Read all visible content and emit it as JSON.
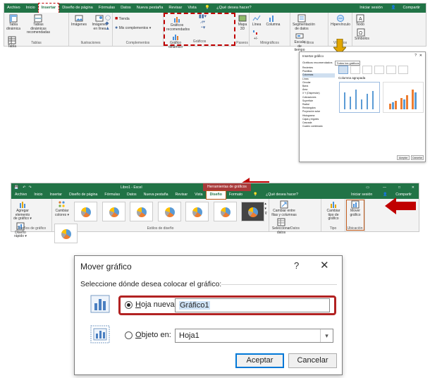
{
  "ribbon1": {
    "tabs": [
      "Archivo",
      "Inicio",
      "Insertar",
      "Diseño de página",
      "Fórmulas",
      "Datos",
      "Nueva pestaña",
      "Revisar",
      "Vista"
    ],
    "tell_me": "¿Qué desea hacer?",
    "signin": "Iniciar sesión",
    "share": "Compartir",
    "groups": {
      "tablas": {
        "label": "Tablas",
        "buttons": [
          "Tabla dinámica",
          "Tablas dinámicas recomendadas",
          "Tabla"
        ]
      },
      "ilustraciones": {
        "label": "Ilustraciones",
        "buttons": [
          "Imágenes",
          "Imágenes en línea"
        ]
      },
      "complementos": {
        "label": "Complementos",
        "buttons": [
          "Tienda",
          "Mis complementos"
        ]
      },
      "graficos": {
        "label": "Gráficos",
        "buttons": [
          "Gráficos recomendados",
          "Gráfico dinámico"
        ]
      },
      "paseos": {
        "label": "Paseos",
        "buttons": [
          "Mapa 3D"
        ]
      },
      "minigraficos": {
        "label": "Minigráficos",
        "buttons": [
          "Línea",
          "Columna",
          "+/-"
        ]
      },
      "filtros": {
        "label": "Filtros",
        "buttons": [
          "Segmentación de datos",
          "Escala de tiempo"
        ]
      },
      "vinculos": {
        "label": "Vínculos",
        "buttons": [
          "Hipervínculo"
        ]
      },
      "texto": {
        "buttons": [
          "Texto",
          "Símbolos"
        ]
      }
    }
  },
  "dialog_small": {
    "title": "Insertar gráfico",
    "tabs": [
      "Gráficos recomendados",
      "Todos los gráficos"
    ],
    "categories": [
      "Recientes",
      "Plantillas",
      "Columnas",
      "Línea",
      "Circular",
      "Barra",
      "Área",
      "X Y (Dispersión)",
      "Cotizaciones",
      "Superficie",
      "Radial",
      "Rectángulos",
      "Proyección solar",
      "Histograma",
      "Cajas y bigotes",
      "Cascada",
      "Cuadro combinado"
    ],
    "heading": "Columna agrupada",
    "ok": "Aceptar",
    "cancel": "Cancelar"
  },
  "ribbon2": {
    "window_title": "Libro1 - Excel",
    "context_title": "Herramientas de gráficos",
    "tabs": [
      "Archivo",
      "Inicio",
      "Insertar",
      "Diseño de página",
      "Fórmulas",
      "Datos",
      "Nueva pestaña",
      "Revisar",
      "Vista",
      "Diseño",
      "Formato"
    ],
    "tell_me": "¿Qué desea hacer?",
    "signin": "Iniciar sesión",
    "share": "Compartir",
    "groups": {
      "diseno": {
        "label": "Diseños de gráfico",
        "buttons": [
          "Agregar elemento de gráfico",
          "Diseño rápido"
        ]
      },
      "estilos": {
        "label": "Estilos de diseño",
        "buttons": [
          "Cambiar colores"
        ]
      },
      "datos": {
        "label": "Datos",
        "buttons": [
          "Cambiar entre filas y columnas",
          "Seleccionar datos"
        ]
      },
      "tipo": {
        "label": "Tipo",
        "buttons": [
          "Cambiar tipo de gráfico"
        ]
      },
      "ubicacion": {
        "label": "Ubicación",
        "buttons": [
          "Mover gráfico"
        ]
      }
    }
  },
  "dialog_move": {
    "title": "Mover gráfico",
    "help": "?",
    "close": "✕",
    "prompt": "Seleccione dónde desea colocar el gráfico:",
    "option_new_label": "Hoja nueva:",
    "option_new_value": "Gráfico1",
    "option_obj_label": "Objeto en:",
    "option_obj_value": "Hoja1",
    "ok": "Aceptar",
    "cancel": "Cancelar"
  },
  "colors": {
    "excel_green": "#217346",
    "highlight_red": "#c00000",
    "arrow_gold": "#e2a600"
  }
}
